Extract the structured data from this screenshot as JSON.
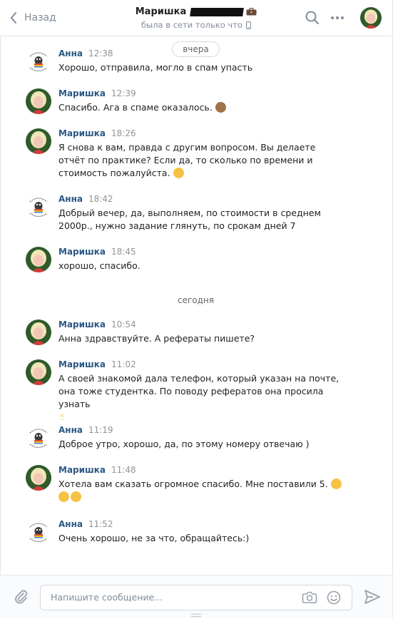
{
  "header": {
    "back_label": "Назад",
    "chat_title": "Маришка",
    "status": "была в сети только что"
  },
  "separators": {
    "yesterday": "вчера",
    "today": "сегодня"
  },
  "messages": [
    {
      "author": "Анна",
      "time": "12:38",
      "text": "Хорошо, отправила, могло в спам упасть",
      "avatar": "logo"
    },
    {
      "author": "Маришка",
      "time": "12:39",
      "text": "Спасибо. Ага в спаме оказалось.",
      "avatar": "photo",
      "emoji": "see-no-evil-monkey"
    },
    {
      "author": "Маришка",
      "time": "18:26",
      "text": "Я снова к вам, правда с другим вопросом. Вы делаете отчёт по практике? Если да, то сколько по времени и стоимость пожалуйста.",
      "avatar": "photo",
      "emoji": "smiling-face"
    },
    {
      "author": "Анна",
      "time": "18:42",
      "text": "Добрый вечер, да, выполняем, по стоимости в среднем 2000р., нужно задание глянуть, по срокам дней 7",
      "avatar": "logo"
    },
    {
      "author": "Маришка",
      "time": "18:45",
      "text": "хорошо, спасибо.",
      "avatar": "photo"
    },
    {
      "author": "Маришка",
      "time": "10:54",
      "text": "Анна здравствуйте. А рефераты пишете?",
      "avatar": "photo"
    },
    {
      "author": "Маришка",
      "time": "11:02",
      "text": "А своей знакомой дала телефон, который указан на почте, она тоже студентка. По поводу рефератов она просила узнать",
      "avatar": "photo",
      "emoji": "pointing-up-hand"
    },
    {
      "author": "Анна",
      "time": "11:19",
      "text": "Доброе утро, хорошо, да, по этому номеру отвечаю )",
      "avatar": "logo"
    },
    {
      "author": "Маришка",
      "time": "11:48",
      "text": "Хотела вам сказать огромное спасибо. Мне поставили 5.",
      "avatar": "photo",
      "emoji": "hugging-face x3"
    },
    {
      "author": "Анна",
      "time": "11:52",
      "text": "Очень хорошо, не за что, обращайтесь:)",
      "avatar": "logo"
    }
  ],
  "composer": {
    "placeholder": "Напишите сообщение..."
  },
  "colors": {
    "author": "#2a5885",
    "muted": "#818c99",
    "accent": "#5181b8"
  }
}
